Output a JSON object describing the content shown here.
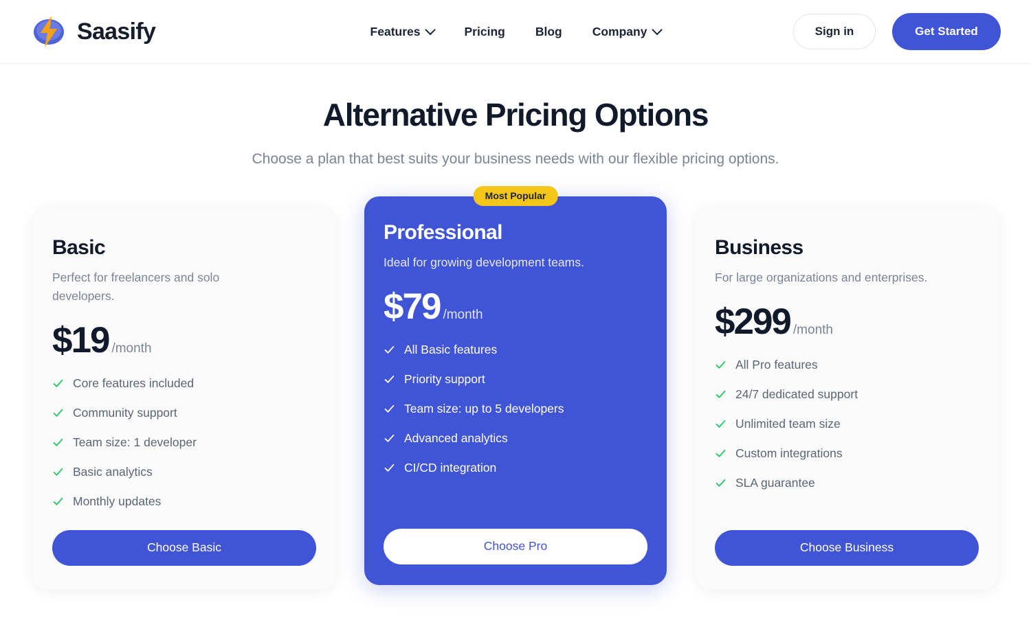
{
  "brand": {
    "name": "Saasify",
    "logo_icon": "lightning-bolt-icon"
  },
  "nav": {
    "items": [
      {
        "label": "Features",
        "has_dropdown": true
      },
      {
        "label": "Pricing",
        "has_dropdown": false
      },
      {
        "label": "Blog",
        "has_dropdown": false
      },
      {
        "label": "Company",
        "has_dropdown": true
      }
    ]
  },
  "header_actions": {
    "signin_label": "Sign in",
    "get_started_label": "Get Started"
  },
  "hero": {
    "title": "Alternative Pricing Options",
    "subtitle": "Choose a plan that best suits your business needs with our flexible pricing options."
  },
  "colors": {
    "accent": "#4054d6",
    "badge": "#f5c518",
    "check_green": "#22c55e",
    "text_dark": "#111a2b",
    "text_muted": "#7b8494",
    "logo_bolt": "#f59f1b"
  },
  "plans": [
    {
      "name": "Basic",
      "description": "Perfect for freelancers and solo developers.",
      "price": "$19",
      "period": "/month",
      "featured": false,
      "badge": null,
      "features": [
        "Core features included",
        "Community support",
        "Team size: 1 developer",
        "Basic analytics",
        "Monthly updates"
      ],
      "cta_label": "Choose Basic"
    },
    {
      "name": "Professional",
      "description": "Ideal for growing development teams.",
      "price": "$79",
      "period": "/month",
      "featured": true,
      "badge": "Most Popular",
      "features": [
        "All Basic features",
        "Priority support",
        "Team size: up to 5 developers",
        "Advanced analytics",
        "CI/CD integration"
      ],
      "cta_label": "Choose Pro"
    },
    {
      "name": "Business",
      "description": "For large organizations and enterprises.",
      "price": "$299",
      "period": "/month",
      "featured": false,
      "badge": null,
      "features": [
        "All Pro features",
        "24/7 dedicated support",
        "Unlimited team size",
        "Custom integrations",
        "SLA guarantee"
      ],
      "cta_label": "Choose Business"
    }
  ]
}
